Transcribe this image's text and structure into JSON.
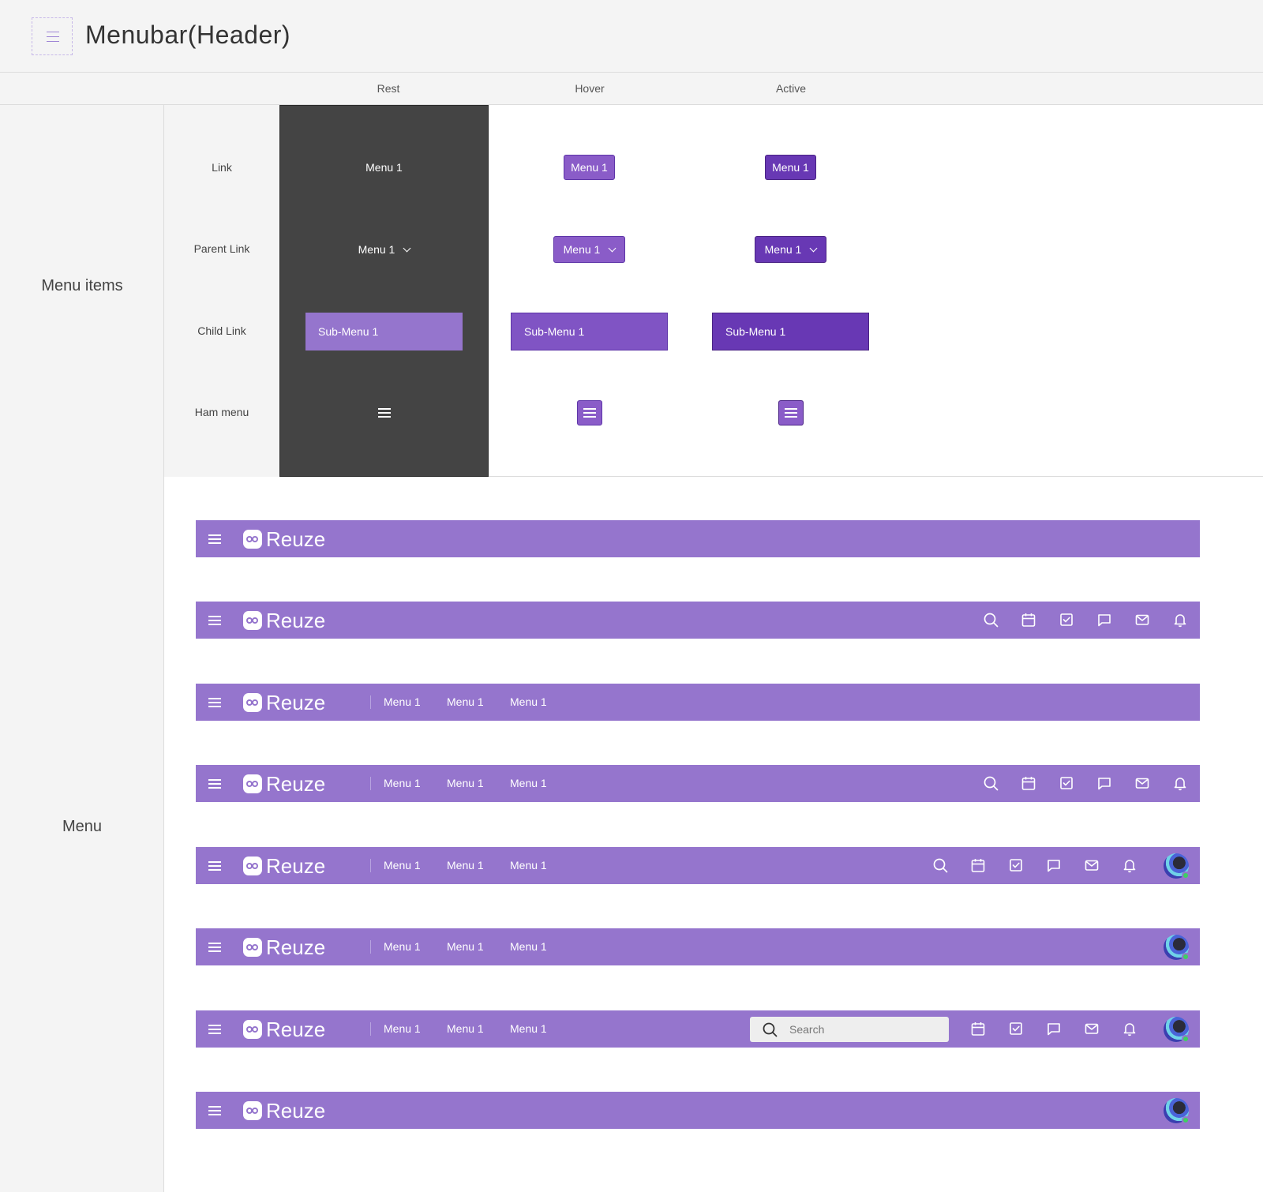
{
  "page": {
    "title": "Menubar(Header)"
  },
  "columns": [
    "Rest",
    "Hover",
    "Active"
  ],
  "sections": {
    "menu_items": "Menu items",
    "menu": "Menu"
  },
  "rows": [
    "Link",
    "Parent Link",
    "Child Link",
    "Ham menu"
  ],
  "items": {
    "link": "Menu 1",
    "parent": "Menu 1",
    "child": "Sub-Menu 1"
  },
  "menubar": {
    "logo": "Reuze",
    "menus": [
      "Menu 1",
      "Menu 1",
      "Menu 1"
    ],
    "search_placeholder": "Search",
    "icons": [
      "search-icon",
      "calendar-icon",
      "task-check-icon",
      "chat-icon",
      "mail-icon",
      "bell-icon"
    ]
  },
  "colors": {
    "menubar": "#9575CD",
    "hover": "#8A5CC8",
    "active": "#6838B4",
    "rest_bg": "#444444"
  }
}
